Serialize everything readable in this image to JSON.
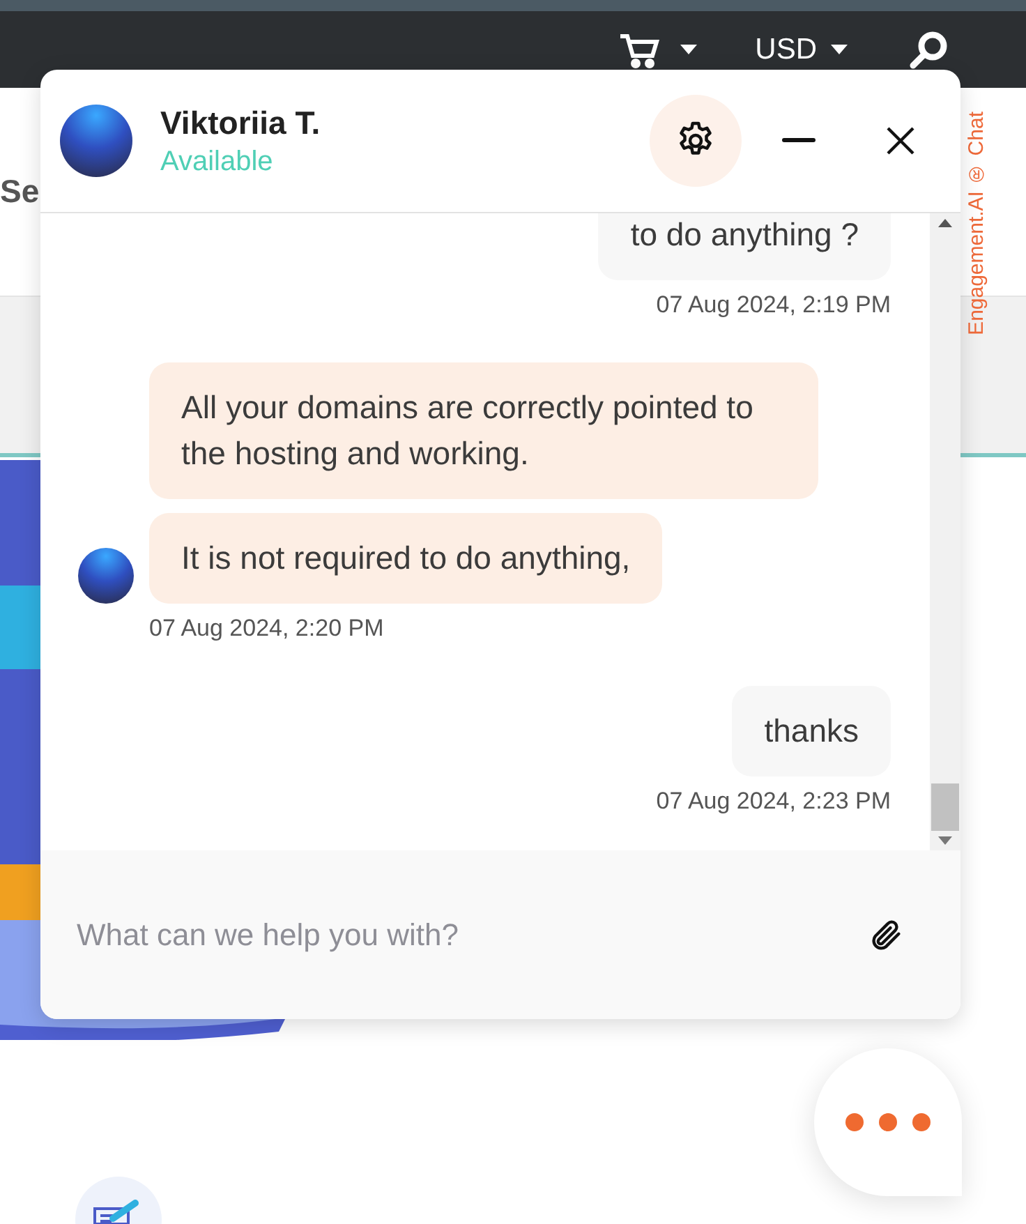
{
  "page": {
    "header": {
      "currency": "USD"
    },
    "partial_heading": "Se"
  },
  "chat": {
    "agent": {
      "name": "Viktoriia T.",
      "status": "Available"
    },
    "messages": [
      {
        "kind": "outgoing",
        "bubbles": [
          "to do anything ?"
        ],
        "time": "07 Aug 2024, 2:19 PM"
      },
      {
        "kind": "incoming",
        "bubbles": [
          "All your domains are correctly pointed to the hosting and working.",
          "It is not required to do anything,"
        ],
        "time": "07 Aug 2024, 2:20 PM"
      },
      {
        "kind": "outgoing",
        "bubbles": [
          "thanks"
        ],
        "time": "07 Aug 2024, 2:23 PM"
      }
    ],
    "input": {
      "placeholder": "What can we help you with?"
    },
    "side_tab": "Engagement.AI ® Chat"
  }
}
